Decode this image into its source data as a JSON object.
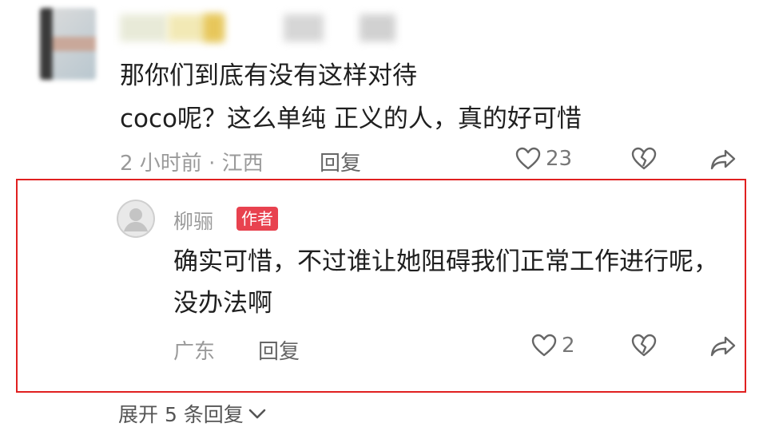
{
  "comment": {
    "text_line1": "那你们到底有没有这样对待",
    "text_line2": "coco呢？这么单纯 正义的人，真的好可惜",
    "meta": "2 小时前 · 江西",
    "reply_label": "回复",
    "like_count": "23",
    "icons": {
      "like": "heart-icon",
      "dislike": "broken-heart-icon",
      "share": "share-arrow-icon"
    }
  },
  "reply": {
    "author": "柳骊",
    "badge": "作者",
    "text": "确实可惜，不过谁让她阻碍我们正常工作进行呢，没办法啊",
    "meta": "广东",
    "reply_label": "回复",
    "like_count": "2",
    "icons": {
      "like": "heart-icon",
      "dislike": "broken-heart-icon",
      "share": "share-arrow-icon"
    }
  },
  "expand": {
    "label": "展开 5 条回复",
    "icon": "chevron-down-icon"
  },
  "colors": {
    "highlight_border": "#e02020",
    "badge_bg": "#e8424f",
    "meta_gray": "#9a9a9a"
  }
}
